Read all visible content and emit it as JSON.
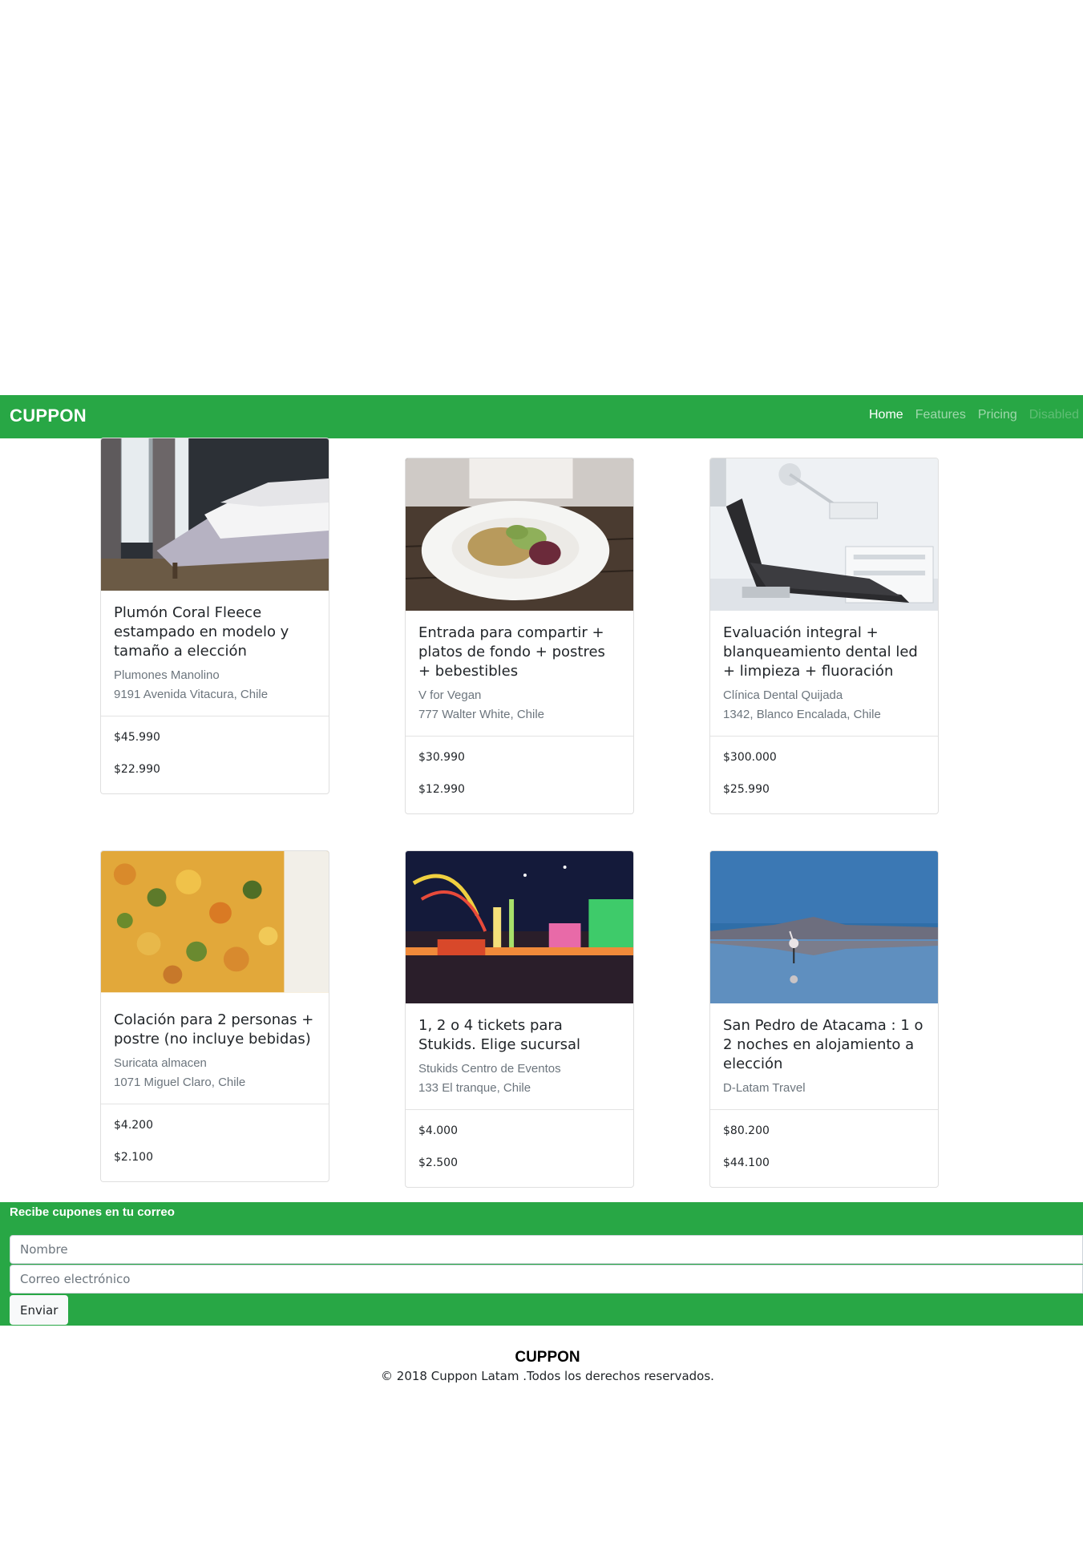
{
  "navbar": {
    "brand": "CUPPON",
    "links": [
      {
        "label": "Home",
        "state": "active"
      },
      {
        "label": "Features",
        "state": "normal"
      },
      {
        "label": "Pricing",
        "state": "normal"
      },
      {
        "label": "Disabled",
        "state": "disabled"
      }
    ]
  },
  "cards": [
    {
      "title": "Plumón Coral Fleece estampado en modelo y tamaño a elección",
      "vendor": "Plumones Manolino",
      "address": "9191 Avenida Vitacura, Chile",
      "price_original": "$45.990",
      "price_offer": "$22.990",
      "image": "bedroom-photo"
    },
    {
      "title": "Entrada para compartir + platos de fondo + postres + bebestibles",
      "vendor": "V for Vegan",
      "address": "777 Walter White, Chile",
      "price_original": "$30.990",
      "price_offer": "$12.990",
      "image": "salad-plate-photo"
    },
    {
      "title": "Evaluación integral + blanqueamiento dental led + limpieza + fluoración",
      "vendor": "Clínica Dental Quijada",
      "address": "1342, Blanco Encalada, Chile",
      "price_original": "$300.000",
      "price_offer": "$25.990",
      "image": "dental-chair-photo"
    },
    {
      "title": "Colación para 2 personas + postre (no incluye bebidas)",
      "vendor": "Suricata almacen",
      "address": "1071 Miguel Claro, Chile",
      "price_original": "$4.200",
      "price_offer": "$2.100",
      "image": "lentil-stew-photo"
    },
    {
      "title": "1, 2 o 4 tickets para Stukids. Elige sucursal",
      "vendor": "Stukids Centro de Eventos",
      "address": "133 El tranque, Chile",
      "price_original": "$4.000",
      "price_offer": "$2.500",
      "image": "fairground-night-photo"
    },
    {
      "title": "San Pedro de Atacama : 1 o 2 noches en alojamiento a elección",
      "vendor": "D-Latam Travel",
      "address": "",
      "price_original": "$80.200",
      "price_offer": "$44.100",
      "image": "atacama-flamingo-photo"
    }
  ],
  "newsletter": {
    "title": "Recibe cupones en tu correo",
    "name_placeholder": "Nombre",
    "email_placeholder": "Correo electrónico",
    "button_label": "Enviar"
  },
  "footer": {
    "brand": "CUPPON",
    "copyright": "© 2018 Cuppon Latam .Todos los derechos reservados."
  },
  "colors": {
    "primary": "#28a745",
    "muted_text": "#6c757d"
  }
}
